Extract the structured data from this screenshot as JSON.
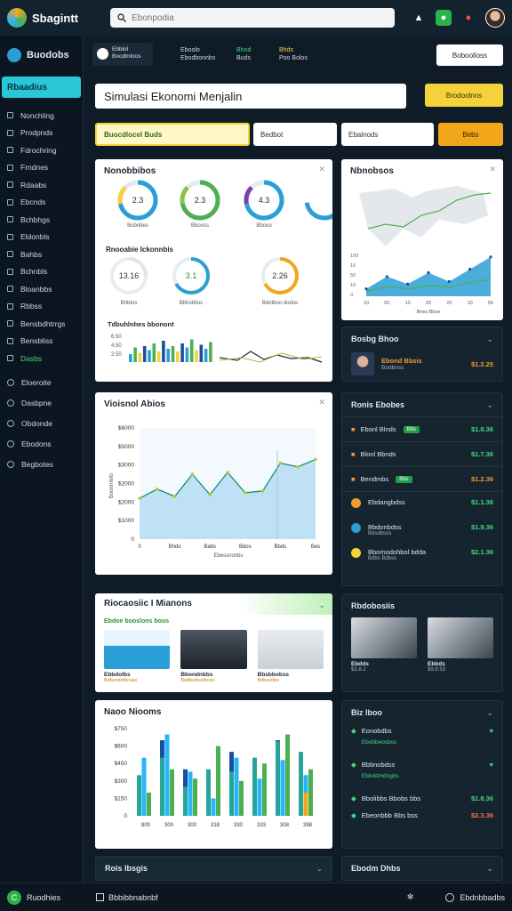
{
  "topbar": {
    "brand": "Sbagintt",
    "search_placeholder": "Ebonpodia"
  },
  "sidebar": {
    "brand": "Buodobs",
    "active": "Rbaadius",
    "items": [
      {
        "label": "Nonchling"
      },
      {
        "label": "Prodpnds"
      },
      {
        "label": "Fdrochring"
      },
      {
        "label": "Frndnes"
      },
      {
        "label": "Rdaabs"
      },
      {
        "label": "Ebcnds"
      },
      {
        "label": "Bchbhgs"
      },
      {
        "label": "Eldonbls"
      },
      {
        "label": "Bahbs"
      },
      {
        "label": "Bchnbls"
      },
      {
        "label": "Bloanbbs"
      },
      {
        "label": "Rbbss"
      },
      {
        "label": "Bensbdhtrrgs"
      },
      {
        "label": "Bensbliss"
      },
      {
        "label": "Dasbs"
      }
    ],
    "items2": [
      {
        "label": "Eloeroite"
      },
      {
        "label": "Dasbpne"
      },
      {
        "label": "Obdonde"
      },
      {
        "label": "Ebodons"
      },
      {
        "label": "Begbotes"
      }
    ]
  },
  "header": {
    "quick_title": "Ebblol",
    "quick_sub": "Boodmloos",
    "stats": [
      {
        "a": "Eboolo",
        "b": "Ebodbonnbs"
      },
      {
        "a": "Bhod",
        "b": "Buds"
      },
      {
        "a": "Bhds",
        "b": "Poo Bolos"
      }
    ],
    "right_button": "Boboolloss"
  },
  "simulation": {
    "title": "Simulasi Ekonomi Menjalin",
    "button": "Brodoolnns",
    "filters": [
      "Buocdlocel Buds",
      "Bedbot",
      "Ebalnods",
      "Bebs"
    ]
  },
  "card_donuts": {
    "title": "Nonobbibos",
    "donuts": [
      {
        "value": "2.3",
        "label": "Bobnbes"
      },
      {
        "value": "2.3",
        "label": "Bbooss"
      },
      {
        "value": "4.3",
        "label": "Bbooo"
      }
    ],
    "sub_title": "Rnooabie Ickonnbis",
    "donuts2": [
      {
        "value": "13.16",
        "label": "Bhbtos"
      },
      {
        "value": "3.1",
        "label": "Bbhobllos"
      },
      {
        "value": "2.26",
        "label": "Bdotboo dodos"
      }
    ],
    "mini_title": "Tdbuhlnhes bbonont",
    "mini_ylabels": [
      "6.50",
      "4.50",
      "2.50"
    ],
    "mini_bars": [
      30,
      55,
      35,
      60,
      45,
      70,
      40,
      80,
      50,
      60,
      40,
      70,
      55,
      85,
      45,
      65,
      50,
      75
    ]
  },
  "card_map": {
    "title": "Nbnobsos",
    "chart_data": {
      "type": "area",
      "x": [
        "10",
        "00",
        "10",
        "20",
        "20",
        "10",
        "50"
      ],
      "series": [
        {
          "values": [
            15,
            40,
            25,
            48,
            30,
            55,
            80
          ]
        },
        {
          "values": [
            10,
            20,
            15,
            22,
            18,
            28,
            35
          ]
        }
      ],
      "ylim": [
        0,
        100
      ],
      "xlabel": "Bnes Bbos"
    }
  },
  "dark_profile": {
    "title": "Bosbg Bhoo",
    "name": "Ebond Bbsis",
    "sub": "Bodbnss",
    "value": "$1.2.25"
  },
  "line_card": {
    "title": "Vioisnol Abios",
    "chart_data": {
      "type": "area",
      "x": [
        "0",
        "Bhdo",
        "Babs",
        "Bdos",
        "Bbds",
        "Bes"
      ],
      "xlabel": "Ebessnonbs",
      "ylabel": "Boonmtels",
      "yticks": [
        "0",
        "$1000",
        "$2000",
        "$2000",
        "$3000",
        "$5000",
        "$6000"
      ],
      "values": [
        2200,
        2700,
        2300,
        3500,
        2400,
        3600,
        2500,
        2600,
        4100,
        3900,
        4300
      ],
      "ylim": [
        0,
        6000
      ]
    }
  },
  "dark_list": {
    "title": "Ronis Ebobes",
    "rows": [
      {
        "label": "Ebonl Blnds",
        "tag": "Bbs",
        "value": "$1.8.36"
      },
      {
        "label": "Blonl Bbnds",
        "tag": "",
        "value": "$1.7.36"
      },
      {
        "label": "Bendmbs",
        "tag": "Bbs",
        "value": "$1.2.36"
      }
    ],
    "rows2": [
      {
        "label": "Ebdangbdss",
        "sub": "",
        "value": "$1.1.36"
      },
      {
        "label": "Bbdonbdss",
        "sub": "Bdsdbsos",
        "value": "$1.9.36"
      },
      {
        "label": "Bbomodohbol bdda",
        "sub": "Bdbs Bdbss",
        "value": "$2.1.36"
      }
    ]
  },
  "ecommerce": {
    "title": "Riocaosiic I Mianons",
    "subtitle": "Ebdoe booslons bous",
    "items": [
      {
        "label": "Ebbdolbs",
        "sub": "Bdboskotbcass"
      },
      {
        "label": "Bbondnbbs",
        "sub": "Bddbotbsdboss"
      },
      {
        "label": "Bbsbbobss",
        "sub": "Bdbsobbs"
      }
    ]
  },
  "dark_photos": {
    "title": "Rbdobosiis",
    "items": [
      {
        "label": "Ebdds",
        "sub": "$3.8.2"
      },
      {
        "label": "Ebbds",
        "sub": "$9.8.53"
      }
    ]
  },
  "bar_card": {
    "title": "Naoo Niooms",
    "chart_data": {
      "type": "bar",
      "categories": [
        "800",
        "300",
        "300",
        "318",
        "330",
        "333",
        "308",
        "398"
      ],
      "yticks": [
        "0",
        "$150",
        "$300",
        "$450",
        "$600",
        "$750"
      ],
      "ylim": [
        0,
        750
      ],
      "series": [
        {
          "name": "blue",
          "values": [
            300,
            650,
            400,
            280,
            550,
            280,
            650,
            500
          ]
        },
        {
          "name": "lightblue",
          "values": [
            500,
            700,
            380,
            150,
            500,
            320,
            480,
            350
          ]
        },
        {
          "name": "green",
          "values": [
            200,
            400,
            320,
            600,
            300,
            450,
            700,
            400
          ]
        },
        {
          "name": "teal",
          "values": [
            350,
            500,
            250,
            400,
            380,
            500,
            640,
            550
          ]
        },
        {
          "name": "orange",
          "values": [
            0,
            0,
            0,
            0,
            0,
            0,
            0,
            200
          ]
        }
      ]
    }
  },
  "dark_checks": {
    "title": "Biz Iboo",
    "rows": [
      {
        "label": "Eonobdbs",
        "sub": "Ebobbeosbss",
        "value": ""
      },
      {
        "label": "Bbbnobdss",
        "sub": "Ebbddmdngbs",
        "value": ""
      },
      {
        "label": "Bbolibbs Bbobs bbs",
        "sub": "",
        "value": "$1.8.36"
      },
      {
        "label": "Ebeonbbb Bbs bss",
        "sub": "",
        "value": "$2.3.36"
      }
    ]
  },
  "bottom_cards": {
    "left": "Rois Ibsgis",
    "right": "Ebodm Dhbs"
  },
  "bottombar": {
    "left": "Ruodhies",
    "mid": "Bbbibbnabnbf",
    "right": "Ebdnbbadbs"
  },
  "colors": {
    "accent": "#29c7d8",
    "yellow": "#f4d33a",
    "orange": "#f2a61a",
    "green": "#42d97c"
  }
}
